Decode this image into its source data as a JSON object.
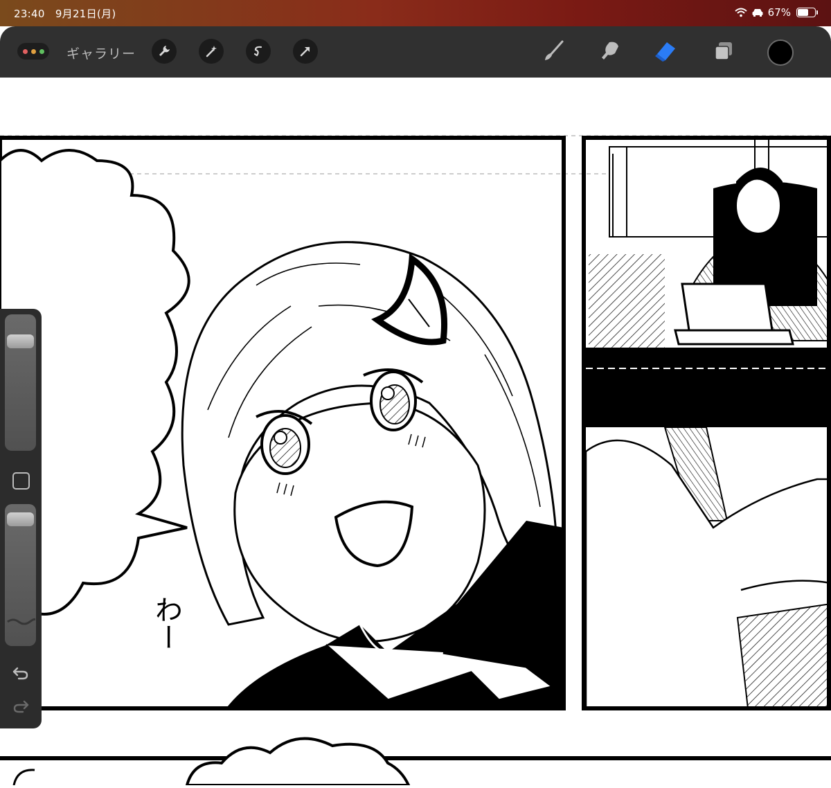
{
  "status": {
    "time": "23:40",
    "date": "9月21日(月)",
    "battery": "67%",
    "battery_level": 0.67
  },
  "toolbar": {
    "gallery_label": "ギャラリー",
    "left_tools": [
      "wrench-icon",
      "magic-wand-icon",
      "selection-icon",
      "transform-arrow-icon"
    ],
    "right_tools": [
      "brush-icon",
      "smudge-icon",
      "eraser-icon",
      "layers-icon"
    ],
    "active_tool": "eraser",
    "active_color": "#000000",
    "accent": "#2b7cf5"
  },
  "canvas": {
    "sfx_text": "わー"
  },
  "sidebar": {
    "brush_size_level": 0.85,
    "opacity_level": 0.95,
    "icons": [
      "modify-square-icon",
      "undo-icon",
      "redo-icon"
    ]
  }
}
